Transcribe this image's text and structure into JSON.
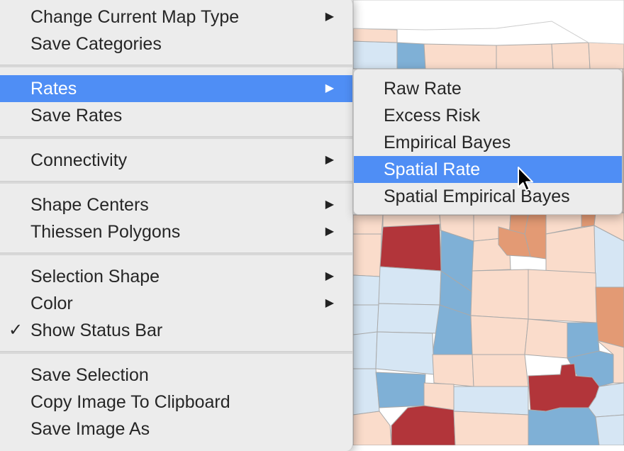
{
  "menu": {
    "groups": [
      [
        {
          "label": "Change Current Map Type",
          "submenu": true
        },
        {
          "label": "Save Categories",
          "submenu": false
        }
      ],
      [
        {
          "label": "Rates",
          "submenu": true,
          "highlighted": true
        },
        {
          "label": "Save Rates",
          "submenu": false
        }
      ],
      [
        {
          "label": "Connectivity",
          "submenu": true
        }
      ],
      [
        {
          "label": "Shape Centers",
          "submenu": true
        },
        {
          "label": "Thiessen Polygons",
          "submenu": true
        }
      ],
      [
        {
          "label": "Selection Shape",
          "submenu": true
        },
        {
          "label": "Color",
          "submenu": true
        },
        {
          "label": "Show Status Bar",
          "submenu": false,
          "checked": true
        }
      ],
      [
        {
          "label": "Save Selection",
          "submenu": false
        },
        {
          "label": "Copy Image To Clipboard",
          "submenu": false
        },
        {
          "label": "Save Image As",
          "submenu": false
        }
      ]
    ],
    "arrow_glyph": "▶",
    "check_glyph": "✓"
  },
  "submenu": {
    "items": [
      {
        "label": "Raw Rate"
      },
      {
        "label": "Excess Risk"
      },
      {
        "label": "Empirical Bayes"
      },
      {
        "label": "Spatial Rate",
        "highlighted": true
      },
      {
        "label": "Spatial Empirical Bayes"
      }
    ]
  },
  "colors": {
    "highlight": "#4f8ef5",
    "menu_bg": "#ececec",
    "map_dark_red": "#b2353a",
    "map_orange": "#e39a74",
    "map_light_peach": "#fadccb",
    "map_light_blue": "#d6e6f4",
    "map_mid_blue": "#7fb0d6"
  },
  "icons": {
    "cursor": "arrow-pointer-icon",
    "checkmark": "checkmark-icon",
    "submenu_arrow": "submenu-arrow-icon"
  }
}
